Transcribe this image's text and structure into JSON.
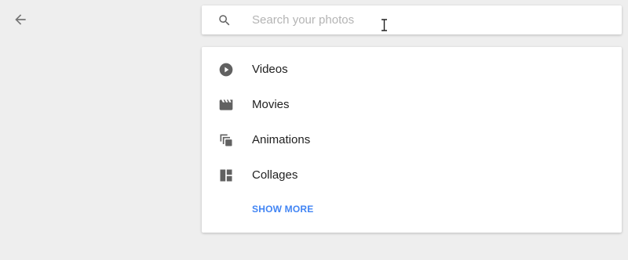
{
  "header": {
    "back_icon": "arrow-back-icon"
  },
  "search": {
    "placeholder": "Search your photos",
    "value": "",
    "icon": "search-icon"
  },
  "menu": {
    "items": [
      {
        "label": "Videos",
        "icon": "play-circle-icon"
      },
      {
        "label": "Movies",
        "icon": "movie-clapper-icon"
      },
      {
        "label": "Animations",
        "icon": "animation-stack-icon"
      },
      {
        "label": "Collages",
        "icon": "collage-grid-icon"
      }
    ],
    "show_more_label": "SHOW MORE"
  },
  "colors": {
    "background": "#eeeeee",
    "card": "#ffffff",
    "icon": "#616161",
    "text": "#212121",
    "placeholder": "#b4b4b4",
    "accent": "#4285f4"
  }
}
